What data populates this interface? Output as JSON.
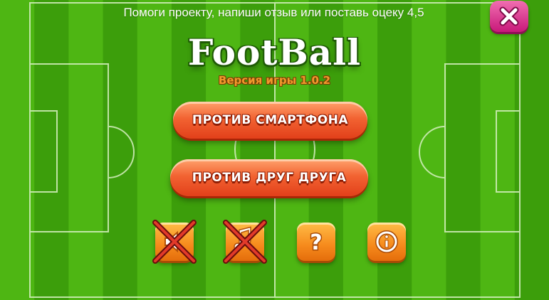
{
  "banner": {
    "text": "Помоги проекту,  напиши отзыв или поставь оцеку 4,5"
  },
  "logo": {
    "title": "FootBall",
    "version": "Версия игры  1.0.2"
  },
  "menu": {
    "vs_smartphone": "Против смартфона",
    "vs_each_other": "Против друг друга"
  },
  "icons": {
    "close": "close-icon",
    "sound": "sound-disabled-icon",
    "music": "music-disabled-icon",
    "help": "question-icon",
    "info": "info-icon"
  },
  "colors": {
    "grass_light": "#4eb613",
    "grass_dark": "#3c9e0b",
    "button_orange": "#f26332",
    "button_pink": "#e03b93",
    "version_orange": "#f19a2c"
  }
}
